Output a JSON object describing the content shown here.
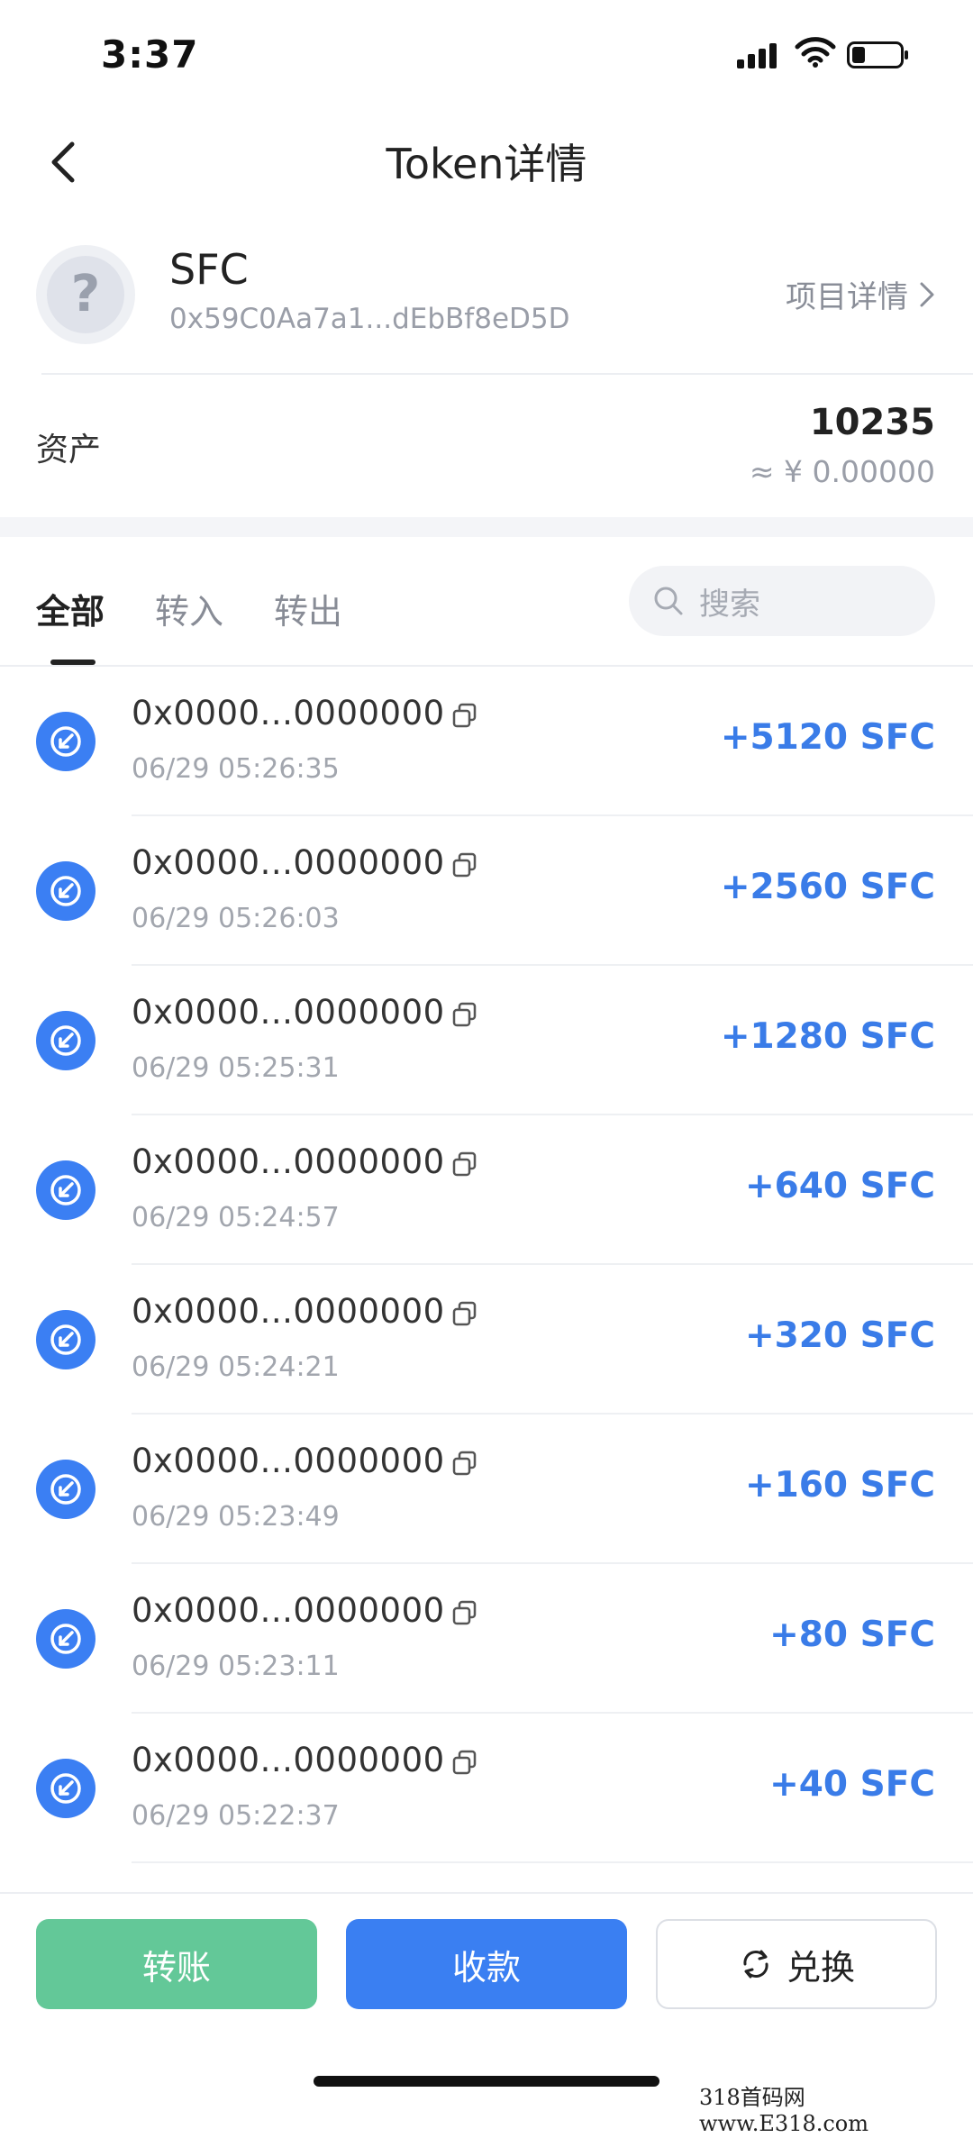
{
  "status_bar": {
    "time": "3:37"
  },
  "header": {
    "title": "Token详情",
    "back_icon": "chevron-left-icon"
  },
  "token": {
    "avatar_glyph": "?",
    "name": "SFC",
    "address": "0x59C0Aa7a1...dEbBf8eD5D",
    "project_details_label": "项目详情"
  },
  "assets": {
    "label": "资产",
    "amount": "10235",
    "fiat": "≈ ¥ 0.00000"
  },
  "tabs": [
    {
      "label": "全部",
      "active": true
    },
    {
      "label": "转入",
      "active": false
    },
    {
      "label": "转出",
      "active": false
    }
  ],
  "search": {
    "placeholder": "搜索"
  },
  "transactions": [
    {
      "address": "0x0000...0000000",
      "time": "06/29 05:26:35",
      "amount": "+5120 SFC",
      "direction": "in"
    },
    {
      "address": "0x0000...0000000",
      "time": "06/29 05:26:03",
      "amount": "+2560 SFC",
      "direction": "in"
    },
    {
      "address": "0x0000...0000000",
      "time": "06/29 05:25:31",
      "amount": "+1280 SFC",
      "direction": "in"
    },
    {
      "address": "0x0000...0000000",
      "time": "06/29 05:24:57",
      "amount": "+640 SFC",
      "direction": "in"
    },
    {
      "address": "0x0000...0000000",
      "time": "06/29 05:24:21",
      "amount": "+320 SFC",
      "direction": "in"
    },
    {
      "address": "0x0000...0000000",
      "time": "06/29 05:23:49",
      "amount": "+160 SFC",
      "direction": "in"
    },
    {
      "address": "0x0000...0000000",
      "time": "06/29 05:23:11",
      "amount": "+80 SFC",
      "direction": "in"
    },
    {
      "address": "0x0000...0000000",
      "time": "06/29 05:22:37",
      "amount": "+40 SFC",
      "direction": "in"
    }
  ],
  "actions": {
    "transfer": "转账",
    "receive": "收款",
    "exchange": "兑换"
  },
  "colors": {
    "accent_blue": "#3a7ff2",
    "amount_blue": "#3a7ce8",
    "transfer_green": "#63c898"
  },
  "watermark": "318首码网 www.E318.com"
}
